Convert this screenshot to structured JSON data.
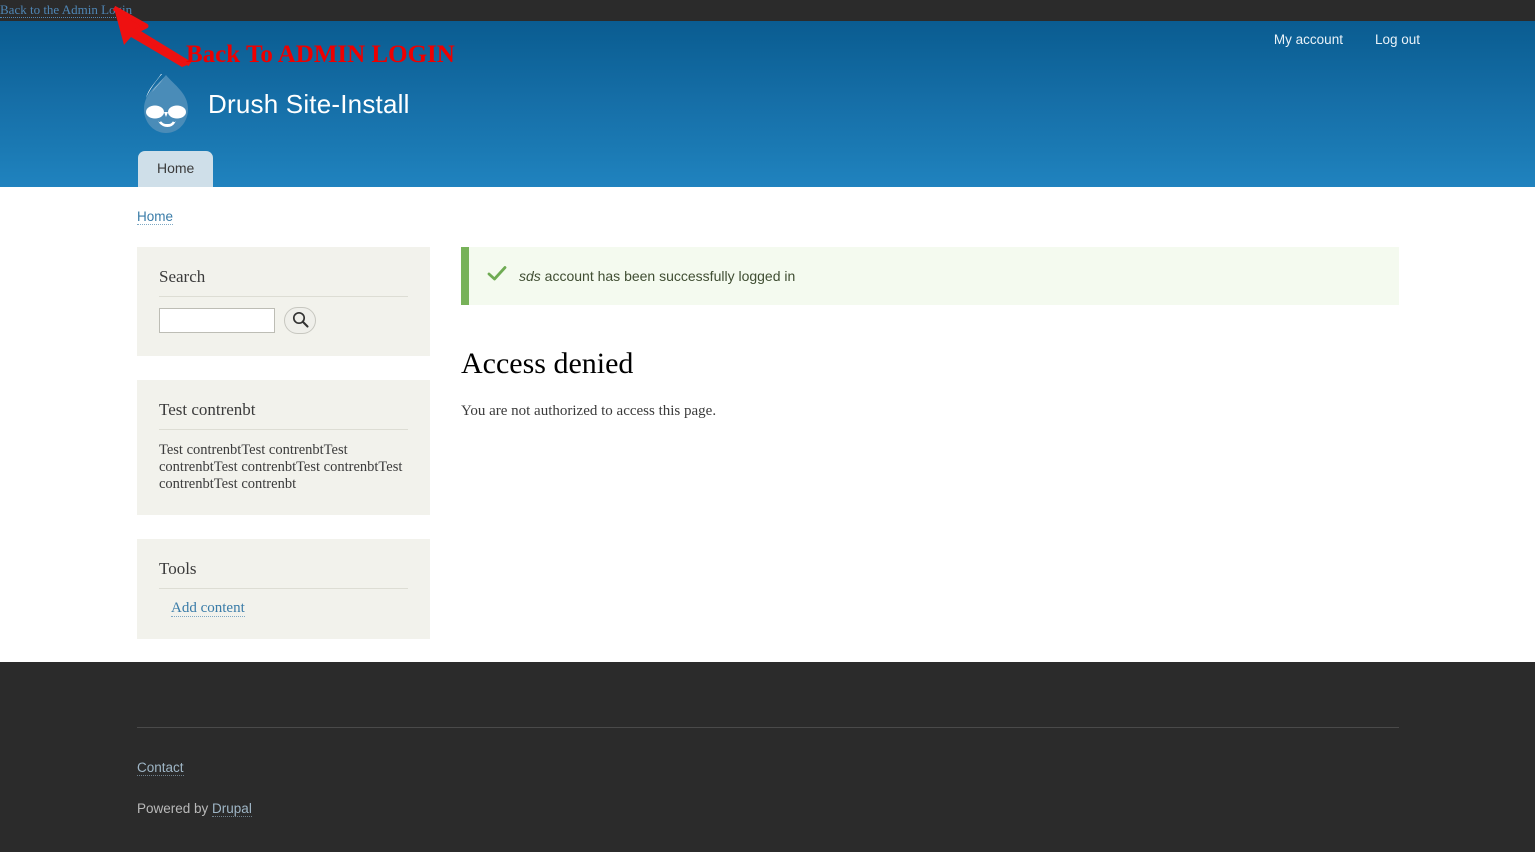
{
  "toolbar": {
    "back_link": "Back to the Admin Login"
  },
  "annotation": {
    "text": "Back To ADMIN LOGIN",
    "color": "#ee0000",
    "arrow_icon": "red-arrow-icon"
  },
  "header": {
    "site_name": "Drush Site-Install",
    "logo_icon": "drupal-druplicon-logo",
    "user_links": [
      {
        "label": "My account"
      },
      {
        "label": "Log out"
      }
    ],
    "menu_tabs": [
      {
        "label": "Home",
        "active": true
      }
    ],
    "gradient_top": "#0a5c91",
    "gradient_bottom": "#2083bf"
  },
  "breadcrumb": {
    "items": [
      {
        "label": "Home"
      }
    ]
  },
  "sidebar": {
    "blocks": [
      {
        "title": "Search",
        "search": {
          "value": "",
          "placeholder": "",
          "button_icon": "search-magnifier-icon"
        }
      },
      {
        "title": "Test contrenbt",
        "body": "Test contrenbtTest contrenbtTest contrenbtTest contrenbtTest contrenbtTest contrenbtTest contrenbt"
      },
      {
        "title": "Tools",
        "links": [
          {
            "label": "Add content"
          }
        ]
      }
    ]
  },
  "main": {
    "status_message": {
      "icon": "green-check-icon",
      "username": "sds",
      "text": " account has been successfully logged in",
      "border_color": "#77b259",
      "background_color": "#f4faef"
    },
    "title": "Access denied",
    "body": "You are not authorized to access this page."
  },
  "footer": {
    "contact_link": "Contact",
    "powered_prefix": "Powered by ",
    "powered_link": "Drupal",
    "background_color": "#2b2b2b"
  }
}
